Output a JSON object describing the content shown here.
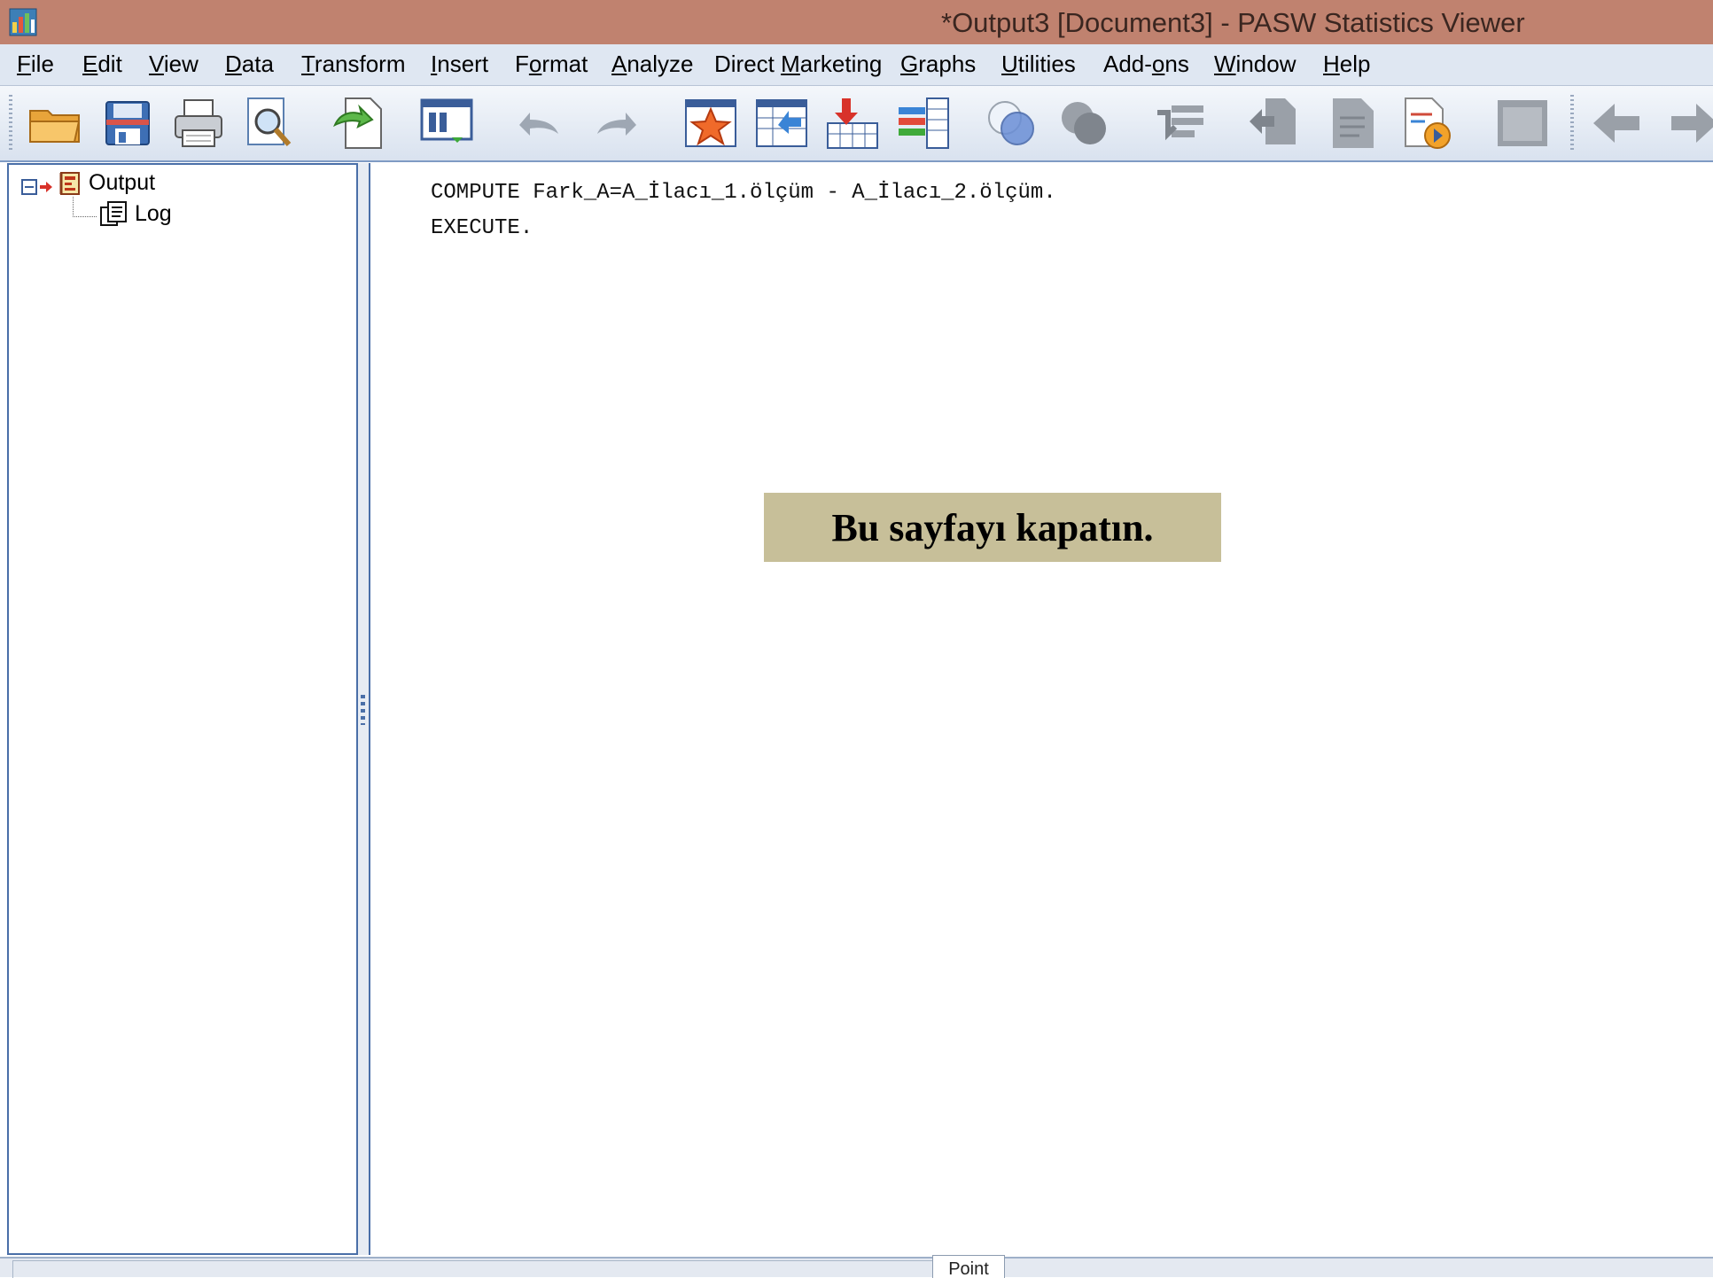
{
  "window": {
    "title": "*Output3 [Document3] - PASW Statistics Viewer",
    "app_icon": "pasw-viewer-icon"
  },
  "menu": [
    {
      "pre": "",
      "u": "F",
      "post": "ile"
    },
    {
      "pre": "",
      "u": "E",
      "post": "dit"
    },
    {
      "pre": "",
      "u": "V",
      "post": "iew"
    },
    {
      "pre": "",
      "u": "D",
      "post": "ata"
    },
    {
      "pre": "",
      "u": "T",
      "post": "ransform"
    },
    {
      "pre": "",
      "u": "I",
      "post": "nsert"
    },
    {
      "pre": "F",
      "u": "o",
      "post": "rmat"
    },
    {
      "pre": "",
      "u": "A",
      "post": "nalyze"
    },
    {
      "pre": "Direct ",
      "u": "M",
      "post": "arketing"
    },
    {
      "pre": "",
      "u": "G",
      "post": "raphs"
    },
    {
      "pre": "",
      "u": "U",
      "post": "tilities"
    },
    {
      "pre": "Add-",
      "u": "o",
      "post": "ns"
    },
    {
      "pre": "",
      "u": "W",
      "post": "indow"
    },
    {
      "pre": "",
      "u": "H",
      "post": "elp"
    }
  ],
  "toolbar": {
    "icons": [
      "open-folder-icon",
      "save-icon",
      "print-icon",
      "print-preview-icon",
      "export-icon",
      "recall-dialog-icon",
      "undo-icon",
      "redo-icon",
      "goto-data-icon",
      "goto-case-icon",
      "insert-cases-icon",
      "variables-icon",
      "select-cases-icon",
      "weight-cases-icon",
      "designate-window-icon",
      "promote-icon",
      "demote-icon",
      "run-script-icon",
      "show-hide-icon",
      "back-icon",
      "forward-icon"
    ]
  },
  "tree": {
    "root_label": "Output",
    "child_label": "Log"
  },
  "log": {
    "lines": [
      "COMPUTE Fark_A=A_İlacı_1.ölçüm - A_İlacı_2.ölçüm.",
      "EXECUTE."
    ]
  },
  "callout": {
    "text": "Bu sayfayı kapatın."
  },
  "statusbar": {
    "tab_label": "Point"
  },
  "colors": {
    "titlebar": "#c0826f",
    "callout_bg": "#c7bf99",
    "pane_border": "#4a6fa8"
  }
}
